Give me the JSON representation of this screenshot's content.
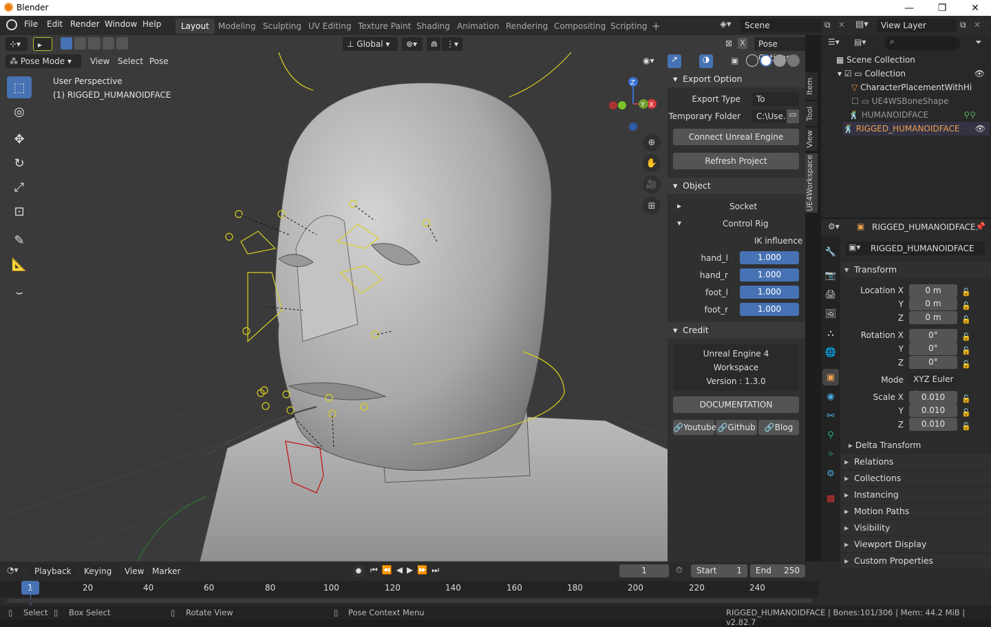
{
  "window": {
    "title": "Blender"
  },
  "menu": [
    "File",
    "Edit",
    "Render",
    "Window",
    "Help"
  ],
  "workspaces": [
    "Layout",
    "Modeling",
    "Sculpting",
    "UV Editing",
    "Texture Paint",
    "Shading",
    "Animation",
    "Rendering",
    "Compositing",
    "Scripting",
    "+"
  ],
  "scene": "Scene",
  "view_layer": "View Layer",
  "viewport": {
    "mode": "Pose Mode",
    "menus": [
      "View",
      "Select",
      "Pose"
    ],
    "orientation": "Global",
    "pose_options": "Pose Options",
    "overlay_title": "User Perspective",
    "overlay_object": "(1) RIGGED_HUMANOIDFACE",
    "axes": {
      "z": "Z",
      "y": "Y",
      "x": "X"
    }
  },
  "npanel": {
    "tabs": [
      "Item",
      "Tool",
      "View",
      "UE4Workspace"
    ],
    "export": {
      "header": "Export Option",
      "type_label": "Export Type",
      "type_value": "To Unrea...",
      "folder_label": "Temporary Folder",
      "folder_value": "C:\\Use..",
      "connect": "Connect Unreal Engine",
      "refresh": "Refresh Project"
    },
    "object": {
      "header": "Object",
      "socket": "Socket",
      "control_rig": "Control Rig",
      "ik": "IK influence",
      "rows": [
        {
          "label": "hand_l",
          "value": "1.000"
        },
        {
          "label": "hand_r",
          "value": "1.000"
        },
        {
          "label": "foot_l",
          "value": "1.000"
        },
        {
          "label": "foot_r",
          "value": "1.000"
        }
      ]
    },
    "credit": {
      "header": "Credit",
      "line1": "Unreal Engine 4",
      "line2": "Workspace",
      "line3": "Version : 1.3.0",
      "docs": "DOCUMENTATION",
      "youtube": "Youtube",
      "github": "Github",
      "blog": "Blog"
    }
  },
  "outliner": {
    "search_placeholder": "",
    "rows": [
      "Scene Collection",
      "Collection",
      "CharacterPlacementWithHi",
      "UE4WSBoneShape",
      "HUMANOIDFACE",
      "RIGGED_HUMANOIDFACE"
    ]
  },
  "properties": {
    "object_name": "RIGGED_HUMANOIDFACE",
    "transform": "Transform",
    "location": {
      "label": "Location X",
      "y": "Y",
      "z": "Z",
      "values": [
        "0 m",
        "0 m",
        "0 m"
      ]
    },
    "rotation": {
      "label": "Rotation X",
      "y": "Y",
      "z": "Z",
      "values": [
        "0°",
        "0°",
        "0°"
      ]
    },
    "mode_label": "Mode",
    "mode_value": "XYZ Euler",
    "scale": {
      "label": "Scale X",
      "y": "Y",
      "z": "Z",
      "values": [
        "0.010",
        "0.010",
        "0.010"
      ]
    },
    "delta": "Delta Transform",
    "sections": [
      "Relations",
      "Collections",
      "Instancing",
      "Motion Paths",
      "Visibility",
      "Viewport Display",
      "Custom Properties"
    ]
  },
  "timeline": {
    "menus": [
      "Playback",
      "Keying",
      "View",
      "Marker"
    ],
    "current_frame": "1",
    "start_label": "Start",
    "start": "1",
    "end_label": "End",
    "end": "250",
    "ruler": [
      "1",
      "20",
      "40",
      "60",
      "80",
      "100",
      "120",
      "140",
      "160",
      "180",
      "200",
      "220",
      "240"
    ]
  },
  "status": {
    "select": "Select",
    "box_select": "Box Select",
    "rotate": "Rotate View",
    "context": "Pose Context Menu",
    "info": "RIGGED_HUMANOIDFACE | Bones:101/306 | Mem: 44.2 MiB | v2.82.7"
  },
  "colors": {
    "accent": "#4772b3",
    "active_object": "#f0a050",
    "bone_yellow": "#d8d020",
    "bone_red": "#c01818"
  }
}
